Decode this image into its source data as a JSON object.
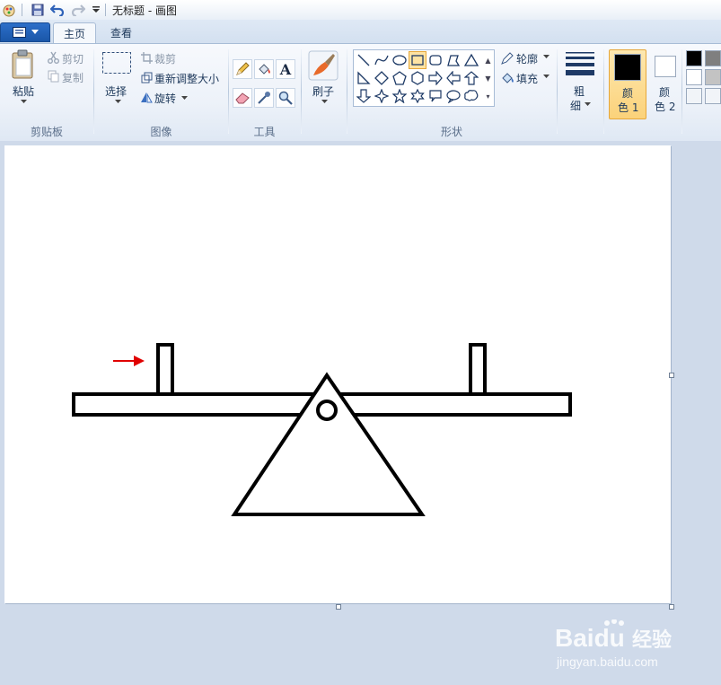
{
  "window": {
    "title": "无标题 - 画图"
  },
  "tabs": [
    {
      "label": "主页",
      "active": true
    },
    {
      "label": "查看",
      "active": false
    }
  ],
  "clipboard": {
    "paste": "粘贴",
    "cut": "剪切",
    "copy": "复制",
    "group": "剪贴板"
  },
  "image": {
    "select": "选择",
    "crop": "裁剪",
    "resize": "重新调整大小",
    "rotate": "旋转",
    "group": "图像"
  },
  "tools": {
    "group": "工具",
    "icons": [
      "pencil-icon",
      "fill-icon",
      "text-icon",
      "eraser-icon",
      "color-picker-icon",
      "magnifier-icon"
    ]
  },
  "brushes": {
    "label": "刷子"
  },
  "shapes": {
    "group": "形状",
    "outline": "轮廓",
    "fill": "填充"
  },
  "size": {
    "label_top": "粗",
    "label_bottom": "细"
  },
  "colors": {
    "color1_top": "颜",
    "color1_bottom": "色 1",
    "color2_top": "颜",
    "color2_bottom": "色 2",
    "color1": "#000000",
    "color2": "#ffffff",
    "palette": [
      "#000000",
      "#7f7f7f",
      "#ffffff",
      "#c3c3c3",
      "#ffffff",
      "#ffffff"
    ],
    "accent_active": "#fbd27a"
  },
  "drawing": {
    "stroke": "#000000",
    "arrow_color": "#e00000"
  },
  "watermark": {
    "brand": "Baidu",
    "brand_cn": "经验",
    "site": "jingyan.baidu.com"
  }
}
